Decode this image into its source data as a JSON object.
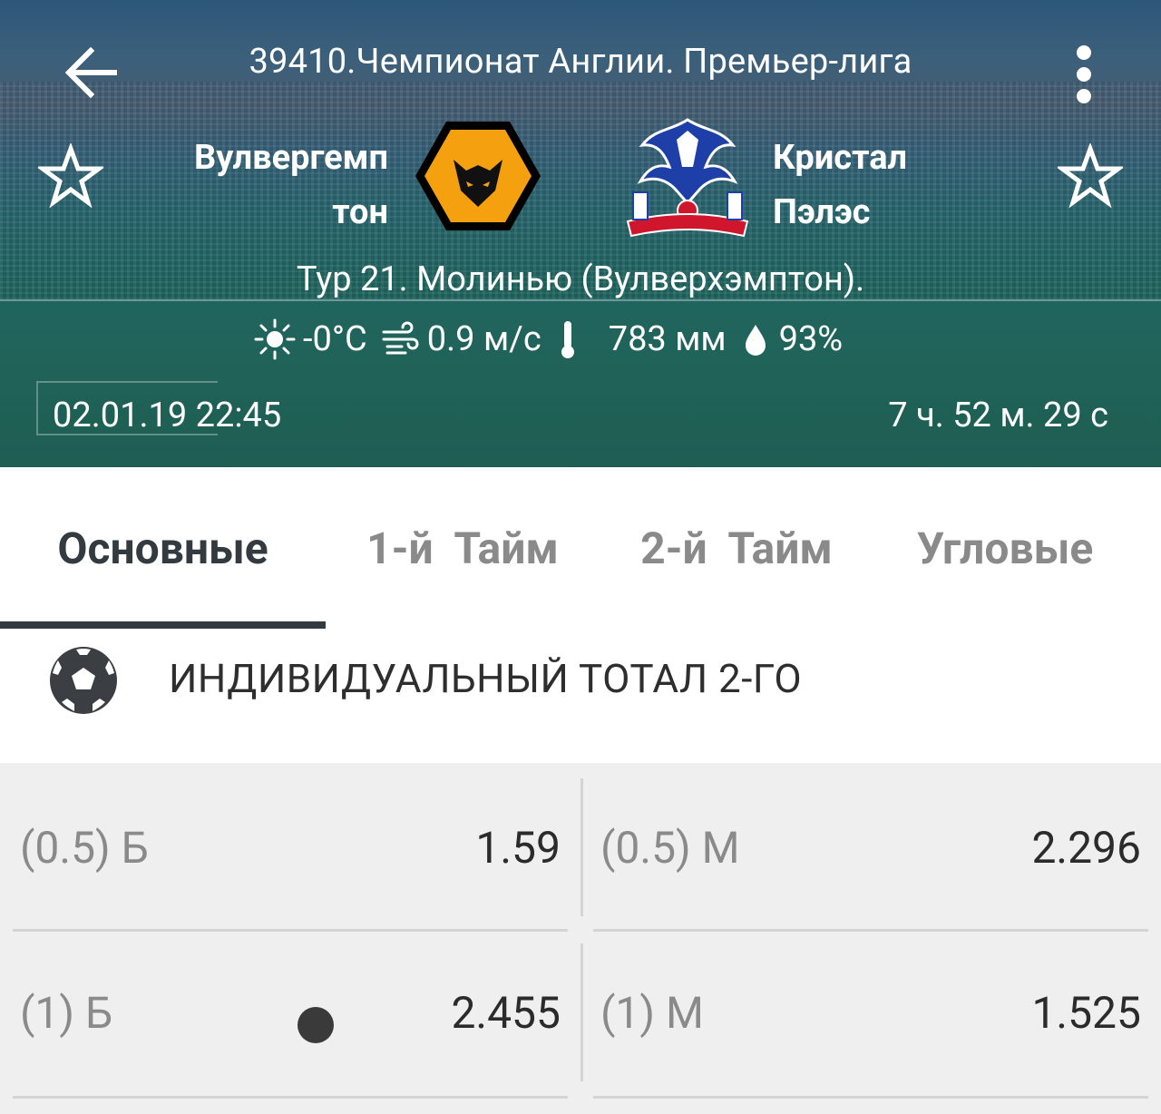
{
  "header": {
    "league_title": "39410.Чемпионат Англии. Премьер-лига",
    "team1": {
      "name": "Вулвергемп\nтон",
      "logo": "wolves-logo"
    },
    "team2": {
      "name": "Кристал\nПэлэс",
      "logo": "crystal-palace-logo"
    },
    "match_info": "Тур 21. Молинью (Вулверхэмптон).",
    "weather": {
      "temperature": "-0°C",
      "wind": "0.9 м/с",
      "pressure": "783 мм",
      "humidity": "93%"
    },
    "date": "02.01.19 22:45",
    "countdown": "7 ч. 52 м. 29 с"
  },
  "tabs": [
    {
      "label": "Основные",
      "active": true
    },
    {
      "label": "1-й  Тайм",
      "active": false
    },
    {
      "label": "2-й  Тайм",
      "active": false
    },
    {
      "label": "Угловые",
      "active": false
    }
  ],
  "section": {
    "title": "ИНДИВИДУАЛЬНЫЙ ТОТАЛ 2-ГО",
    "icon": "soccer-ball-icon"
  },
  "bets": [
    [
      {
        "label": "(0.5) Б",
        "value": "1.59"
      },
      {
        "label": "(0.5) М",
        "value": "2.296"
      }
    ],
    [
      {
        "label": "(1) Б",
        "value": "2.455"
      },
      {
        "label": "(1) М",
        "value": "1.525"
      }
    ]
  ],
  "colors": {
    "active_tab": "#333a40",
    "inactive_tab": "#8a8a8a",
    "bets_bg": "#efefef"
  }
}
